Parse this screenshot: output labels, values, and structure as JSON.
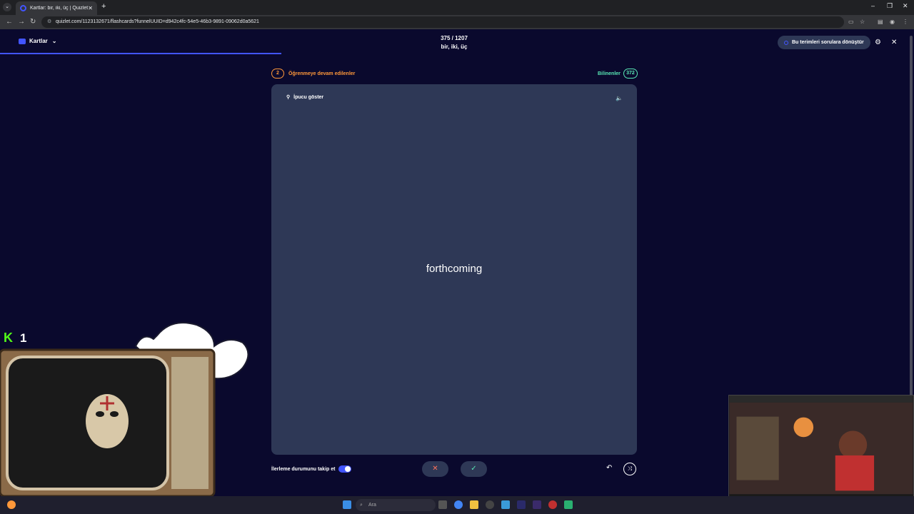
{
  "browser": {
    "tab_title": "Kartlar: bir, iki, üç | Quizlet",
    "url": "quizlet.com/1123132671/flashcards?funnelUUID=d942c4fc-54e5-46b3-9891-09062d0a5621"
  },
  "header": {
    "mode_label": "Kartlar",
    "progress_text": "375 / 1207",
    "set_title": "bir, iki, üç",
    "convert_button": "Bu terimleri sorulara dönüştür",
    "progress_fraction": 0.31
  },
  "status": {
    "learning_count": "2",
    "learning_label": "Öğrenmeye devam edilenler",
    "known_label": "Bilinenler",
    "known_count": "372"
  },
  "card": {
    "hint_label": "İpucu göster",
    "term": "forthcoming"
  },
  "footer": {
    "track_progress_label": "İlerleme durumunu takip et",
    "track_progress_on": true
  },
  "taskbar": {
    "search_placeholder": "Ara"
  },
  "overlay": {
    "kick_count": "1"
  },
  "colors": {
    "background": "#0a092d",
    "card": "#2e3856",
    "accent": "#4255ff",
    "learning": "#ff983a",
    "known": "#59e8b5"
  }
}
